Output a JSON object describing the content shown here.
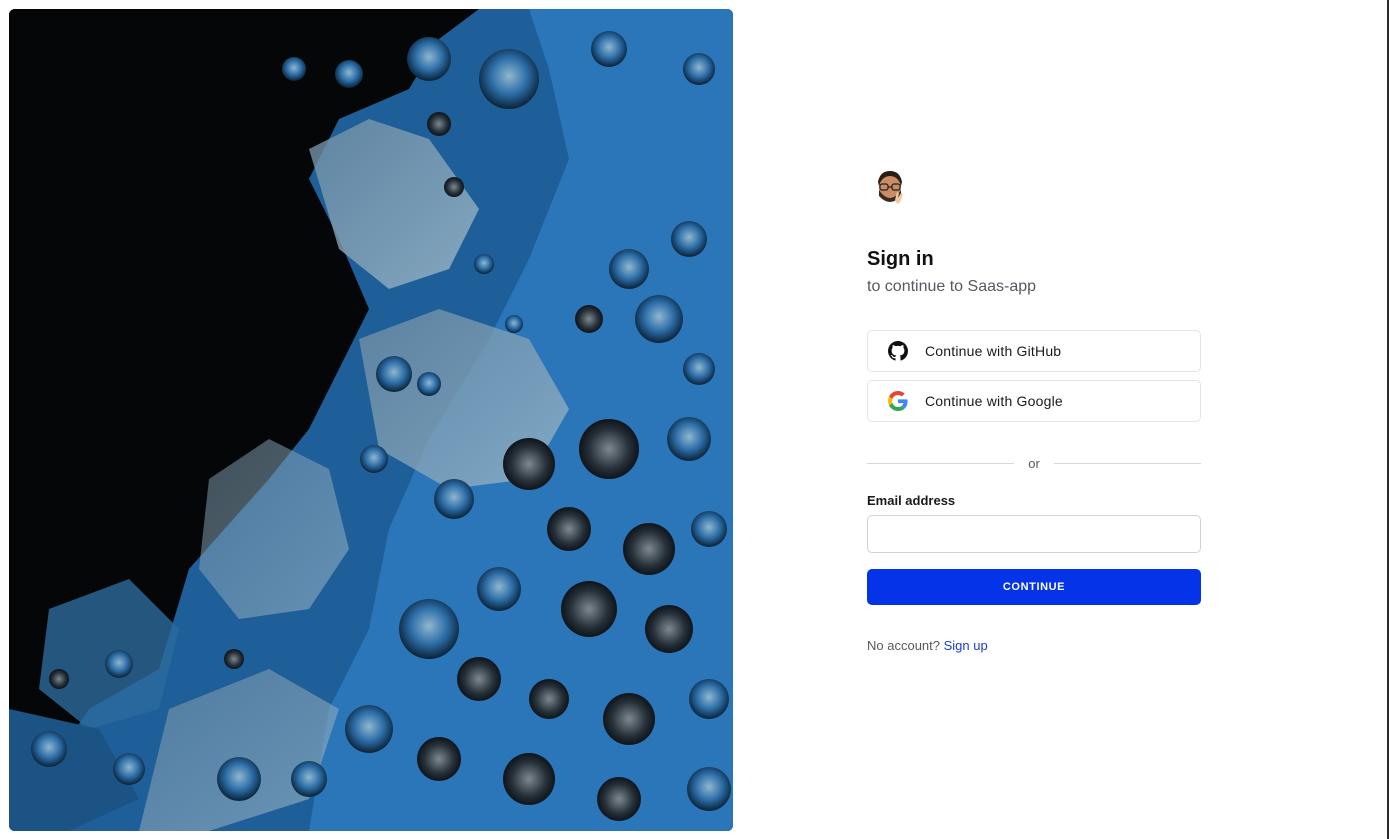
{
  "art": {
    "description_icon": "abstract-blue-fluid-art"
  },
  "signin": {
    "avatar_icon": "memoji-avatar-icon",
    "title": "Sign in",
    "subtitle": "to continue to Saas-app",
    "github_label": "Continue with GitHub",
    "google_label": "Continue with Google",
    "divider_text": "or",
    "email_label": "Email address",
    "email_value": "",
    "email_placeholder": "",
    "continue_label": "CONTINUE",
    "no_account_text": "No account?",
    "signup_link": "Sign up"
  },
  "colors": {
    "primary": "#0433e8",
    "link": "#1a3ecf",
    "border": "#e3e5e8"
  }
}
